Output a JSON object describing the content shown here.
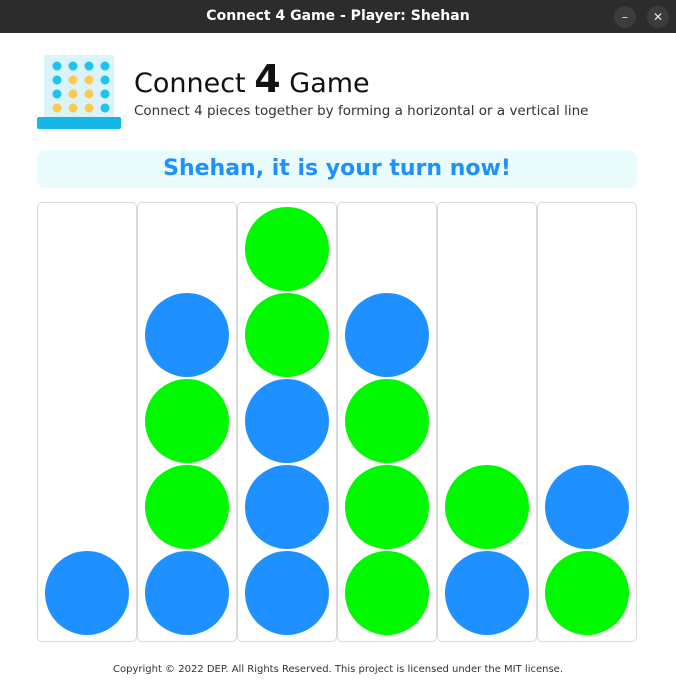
{
  "window": {
    "title": "Connect 4 Game - Player: Shehan",
    "minimize_icon": "minimize-icon",
    "close_icon": "close-icon"
  },
  "header": {
    "title_prefix": "Connect",
    "title_number": "4",
    "title_suffix": "Game",
    "subtitle": "Connect 4 pieces together by forming a horizontal or a vertical line",
    "logo_icon": "connect4-grid-icon"
  },
  "status": {
    "turn_message": "Shehan, it is your turn now!"
  },
  "colors": {
    "blue_piece": "#1f90ff",
    "green_piece": "#00f800",
    "turn_banner_bg": "#e9fcfb",
    "turn_text": "#1f90ff"
  },
  "board": {
    "columns": 6,
    "rows": 5,
    "columns_bottom_to_top": [
      [
        "blue"
      ],
      [
        "blue",
        "green",
        "green",
        "blue"
      ],
      [
        "blue",
        "blue",
        "blue",
        "green",
        "green"
      ],
      [
        "green",
        "green",
        "green",
        "blue"
      ],
      [
        "blue",
        "green"
      ],
      [
        "green",
        "blue"
      ]
    ]
  },
  "footer": {
    "copyright": "Copyright © 2022 DEP. All Rights Reserved. This project is licensed under the MIT license."
  }
}
